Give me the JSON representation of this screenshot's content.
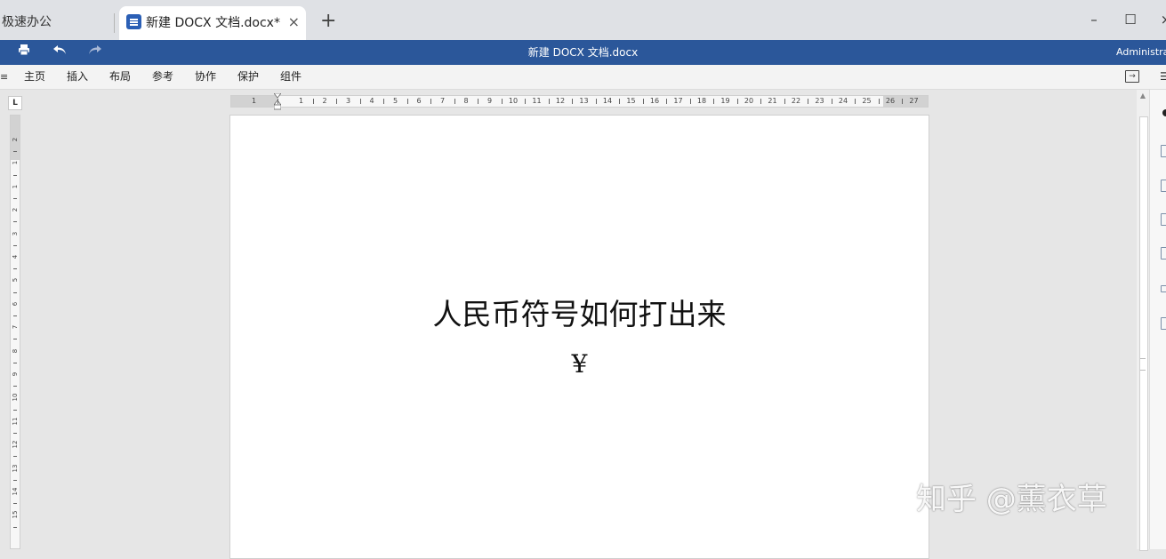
{
  "tabs": {
    "app_label": "极速办公",
    "active_title": "新建 DOCX 文档.docx*",
    "close_glyph": "×",
    "add_glyph": "+"
  },
  "window": {
    "minimize": "–",
    "maximize": "☐",
    "close": "×"
  },
  "titlebar": {
    "doc_title": "新建 DOCX 文档.docx",
    "user": "Administrat",
    "print_icon": "print-icon",
    "undo_icon": "undo-icon",
    "redo_icon": "redo-icon",
    "accent": "#2b579a"
  },
  "menu": {
    "left_glyph": "≡",
    "items": [
      "主页",
      "插入",
      "布局",
      "参考",
      "协作",
      "保护",
      "组件"
    ],
    "far_glyph": "☰"
  },
  "ruler": {
    "corner": "L",
    "h_numbers": [
      "1",
      "1",
      "2",
      "3",
      "4",
      "5",
      "6",
      "7",
      "8",
      "9",
      "10",
      "11",
      "12",
      "13",
      "14",
      "15",
      "16",
      "17",
      "18",
      "19",
      "20",
      "21",
      "22",
      "23",
      "24",
      "25",
      "26",
      "27"
    ],
    "v_numbers": [
      "2",
      "1",
      "1",
      "2",
      "3",
      "4",
      "5",
      "6",
      "7",
      "8",
      "9",
      "10",
      "11",
      "12",
      "13",
      "14",
      "15"
    ]
  },
  "document": {
    "heading": "人民币符号如何打出来",
    "symbol": "¥"
  },
  "watermark": "知乎 @薰衣草"
}
